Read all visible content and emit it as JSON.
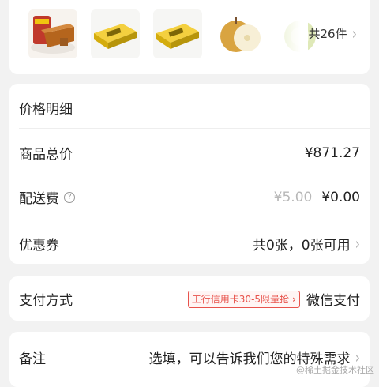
{
  "products": {
    "total_label": "共26件",
    "items": [
      {
        "name": "product-cake"
      },
      {
        "name": "product-box-1"
      },
      {
        "name": "product-box-2"
      },
      {
        "name": "product-pear"
      },
      {
        "name": "product-melon"
      }
    ]
  },
  "price_detail": {
    "header": "价格明细",
    "goods_total_label": "商品总价",
    "goods_total_value": "¥871.27",
    "shipping_label": "配送费",
    "shipping_original": "¥5.00",
    "shipping_value": "¥0.00",
    "coupon_label": "优惠券",
    "coupon_value": "共0张，0张可用"
  },
  "payment": {
    "label": "支付方式",
    "promo": "工行信用卡30-5限量抢",
    "method": "微信支付"
  },
  "remark": {
    "label": "备注",
    "placeholder": "选填，可以告诉我们您的特殊需求"
  },
  "watermark": "@稀土掘金技术社区",
  "colors": {
    "accent": "#e8534c",
    "background": "#f2f2f2"
  }
}
